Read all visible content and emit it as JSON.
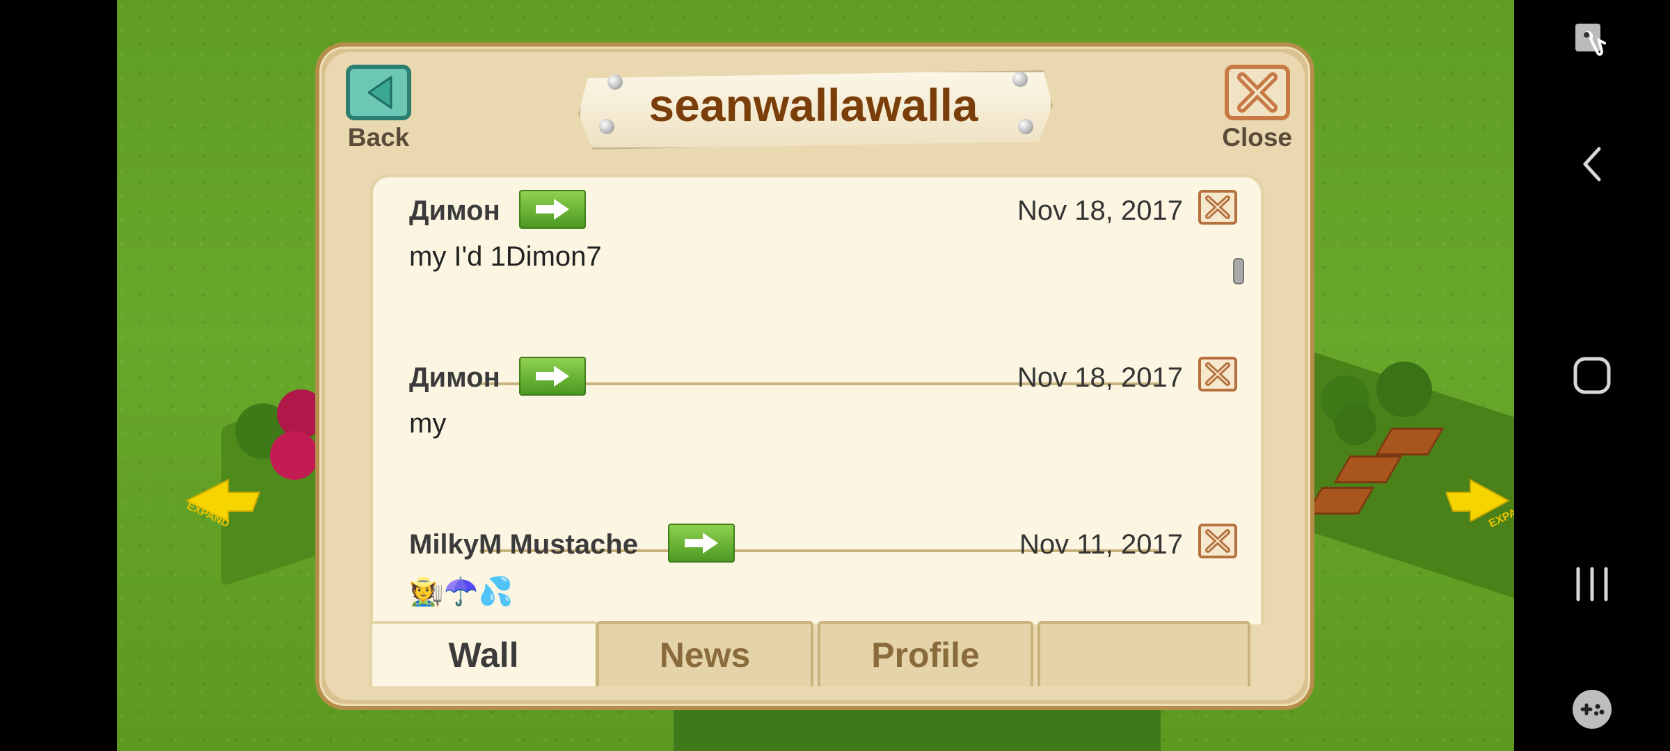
{
  "dialog": {
    "title": "seanwallawalla",
    "back_label": "Back",
    "close_label": "Close"
  },
  "posts": [
    {
      "author": "Димон",
      "date": "Nov 18, 2017",
      "message": "my I'd 1Dimon7"
    },
    {
      "author": "Димон",
      "date": "Nov 18, 2017",
      "message": "my"
    },
    {
      "author": "MilkyM Mustache",
      "date": "Nov 11, 2017",
      "message": "🧑‍🌾☂️💦"
    }
  ],
  "tabs": [
    {
      "label": "Wall",
      "active": true
    },
    {
      "label": "News",
      "active": false
    },
    {
      "label": "Profile",
      "active": false
    },
    {
      "label": "",
      "active": false
    }
  ],
  "expand_label": "EXPAND",
  "colors": {
    "accent_green": "#4c9a22",
    "title_brown": "#7a3e0a",
    "panel": "#ead9b0"
  },
  "system_nav": {
    "icons": [
      "accessibility-touch-icon",
      "back-icon",
      "home-icon",
      "recents-icon",
      "game-launcher-icon"
    ]
  }
}
